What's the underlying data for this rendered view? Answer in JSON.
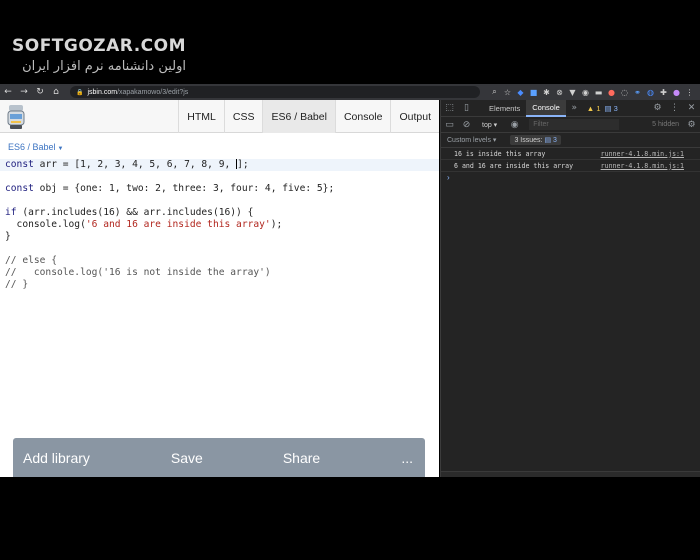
{
  "watermark": {
    "logo": "SOFTGOZAR.COM",
    "subtitle": "اولین دانشنامه نرم افزار ایران"
  },
  "browser": {
    "url_host": "jsbin.com",
    "url_path": "/xapakamowo/3/edit?js",
    "nav_icons": [
      "back-icon",
      "forward-icon",
      "reload-icon",
      "home-icon"
    ]
  },
  "jsbin": {
    "tabs": [
      "HTML",
      "CSS",
      "ES6 / Babel",
      "Console",
      "Output"
    ],
    "active_tab": "ES6 / Babel",
    "language": "ES6 / Babel",
    "code": {
      "l1_kw": "const",
      "l1_rest": " arr = [1, 2, 3, 4, 5, 6, 7, 8, 9, ",
      "l1_end": "];",
      "l3_kw": "const",
      "l3_rest": " obj = {one: 1, two: 2, three: 3, four: 4, five: 5};",
      "l5_kw": "if",
      "l5_rest": " (arr.includes(16) && arr.includes(16)) {",
      "l6_pre": "  console.log(",
      "l6_str": "'6 and 16 are inside this array'",
      "l6_post": ");",
      "l7": "}",
      "l9": "// else {",
      "l10": "//   console.log('16 is not inside the array')",
      "l11": "// }"
    },
    "bottom_bar": {
      "add_library": "Add library",
      "save": "Save",
      "share": "Share",
      "more": "..."
    }
  },
  "devtools": {
    "tabs": [
      "Elements",
      "Console"
    ],
    "more_tabs": "»",
    "warning_count": "1",
    "message_count": "3",
    "context": "top",
    "filter_placeholder": "Filter",
    "hidden": "5 hidden",
    "levels": "Custom levels",
    "issues_label": "3 Issues:",
    "issues_count": "3",
    "logs": [
      {
        "text": "16 is inside this array",
        "source": "runner-4.1.8.min.js:1"
      },
      {
        "text": "6 and 16 are inside this array",
        "source": "runner-4.1.8.min.js:1"
      }
    ],
    "prompt": "›"
  }
}
